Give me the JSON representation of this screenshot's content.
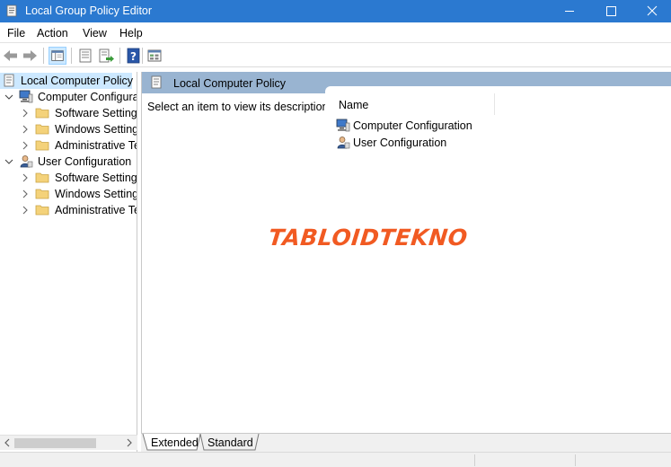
{
  "window": {
    "title": "Local Group Policy Editor",
    "accent_color": "#2b79d0",
    "controls": [
      "minimize-icon",
      "maximize-icon",
      "close-icon"
    ]
  },
  "menu": {
    "file": "File",
    "action": "Action",
    "view": "View",
    "help": "Help"
  },
  "toolbar": {
    "buttons": [
      "back-arrow-icon",
      "forward-arrow-icon",
      "show-hide-tree-icon",
      "properties-icon",
      "export-list-icon",
      "help-icon",
      "filter-view-icon"
    ]
  },
  "tree": {
    "root": "Local Computer Policy",
    "computer_config": "Computer Configura",
    "computer_children": [
      "Software Settings",
      "Windows Setting",
      "Administrative Te"
    ],
    "user_config": "User Configuration",
    "user_children": [
      "Software Settings",
      "Windows Setting",
      "Administrative Te"
    ]
  },
  "right_pane": {
    "header": "Local Computer Policy",
    "description": "Select an item to view its description.",
    "column_name": "Name",
    "items": [
      "Computer Configuration",
      "User Configuration"
    ],
    "header_color": "#99b4d1"
  },
  "watermark": {
    "text": "TABLOIDTEKNO",
    "color": "#f15a22"
  },
  "tabs": {
    "extended": "Extended",
    "standard": "Standard",
    "active": "Extended"
  }
}
